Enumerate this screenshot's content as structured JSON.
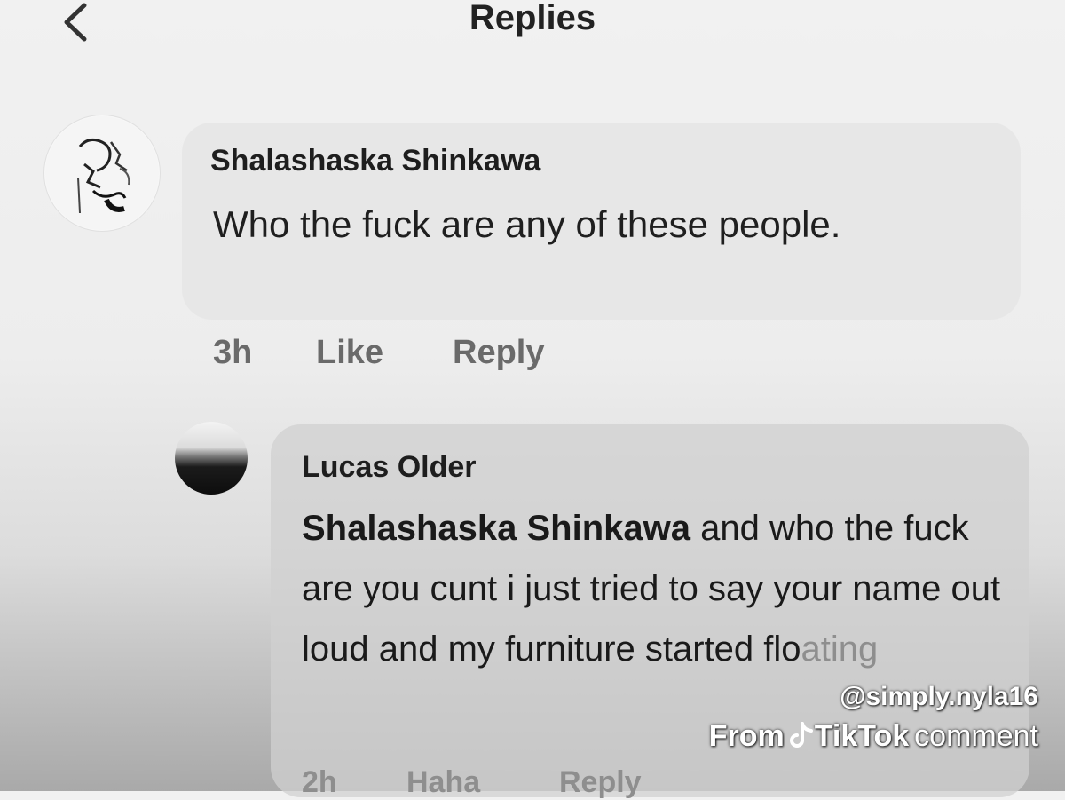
{
  "header": {
    "title": "Replies",
    "back_icon": "chevron-left-icon"
  },
  "comment": {
    "author": "Shalashaska Shinkawa",
    "text": "Who the fuck are any of these people.",
    "time": "3h",
    "like_label": "Like",
    "reply_label": "Reply"
  },
  "reply": {
    "author": "Lucas Older",
    "mention": "Shalashaska Shinkawa",
    "text": "and who the fuck are you cunt i just tried to say your name out loud and my furniture started flo",
    "text_obscured": "ating",
    "time": "2h",
    "haha_label": "Haha",
    "reply_label": "Reply"
  },
  "watermark": {
    "handle": "@simply.nyla16",
    "from_prefix": "From",
    "app": "TikTok",
    "suffix": "comment",
    "icon": "tiktok-note-icon"
  },
  "colors": {
    "background": "#efefef",
    "bubble": "#e7e7e7",
    "meta_text": "#6a6a6a",
    "watermark": "#ffffff"
  }
}
